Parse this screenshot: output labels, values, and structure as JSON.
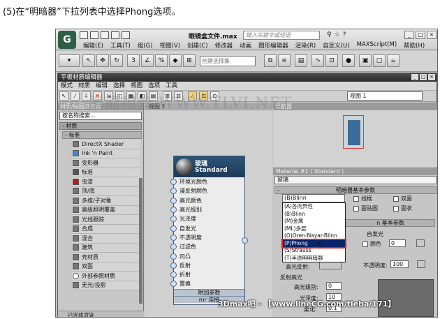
{
  "caption": "(5)在“明暗器”下拉列表中选择Phong选项。",
  "max": {
    "doc_title": "眼镜盒文件.max",
    "search_placeholder": "键入关键字或短语",
    "menu": [
      "编辑(E)",
      "工具(T)",
      "组(G)",
      "视图(V)",
      "创建(C)",
      "修改器",
      "动画",
      "图形编辑器",
      "渲染(R)",
      "自定义(U)",
      "MAXScript(M)",
      "帮助(H)"
    ],
    "selection_set": "创建选择集",
    "logo": "G"
  },
  "slate": {
    "title": "平板材质编辑器",
    "menu": [
      "模式",
      "材质",
      "编辑",
      "选择",
      "视图",
      "选项",
      "工具"
    ],
    "view_select": "视图 1",
    "view_tab": "视图 1",
    "navigator": "导航器"
  },
  "browser": {
    "header": "材质/贴图浏览器",
    "search": "按名称搜索...",
    "category": "- 材质",
    "subcategory": "- 标准",
    "items": [
      "DirectX Shader",
      "Ink 'n Paint",
      "变形器",
      "标准",
      "虫漆",
      "顶/底",
      "多维/子对象",
      "高级照明覆盖",
      "光线跟踪",
      "合成",
      "混合",
      "建筑",
      "壳材质",
      "双面",
      "外部参照材质",
      "无光/投影"
    ],
    "status": "已完成渲染"
  },
  "node": {
    "name": "玻璃",
    "type": "Standard",
    "ports": [
      "环境光颜色",
      "漫反射颜色",
      "高光颜色",
      "高光级别",
      "光泽度",
      "自发光",
      "不透明度",
      "过滤色",
      "凹凸",
      "反射",
      "折射",
      "置换"
    ],
    "footer": "附加参数",
    "footer2": "mr 连接"
  },
  "watermark": "騰龍視覺 WWW.TLVI.NET",
  "material": {
    "header": "Material #1 ( Standard )",
    "name": "玻璃",
    "rollout_basic": "明暗器基本参数",
    "shader_value": "(B)Blinn",
    "checks": [
      "线框",
      "双面",
      "面贴图",
      "面状"
    ],
    "rollout2": "n 基本参数",
    "self_illum": "自发光",
    "color_label": "颜色",
    "color_value": "0",
    "opacity_label": "不透明度:",
    "opacity_value": "100",
    "highlight_reflect": "高光反射:",
    "reflect_highlight_title": "反射高光",
    "spec_level_label": "高光级别:",
    "spec_level_value": "0",
    "gloss_label": "光泽度:",
    "gloss_value": "10",
    "soften_label": "柔化:",
    "soften_value": "0.1",
    "options": [
      "(A)各向异性",
      "(B)Blinn",
      "(M)金属",
      "(ML)多层",
      "(O)Oren-Nayar-Blinn",
      "(P)Phong",
      "(S)Strauss",
      "(T)半透明明暗器"
    ],
    "selected_option": "(P)Phong"
  },
  "footer_watermark": "3Dmax吧 - 【www.lineCG.com/tieba/171】"
}
